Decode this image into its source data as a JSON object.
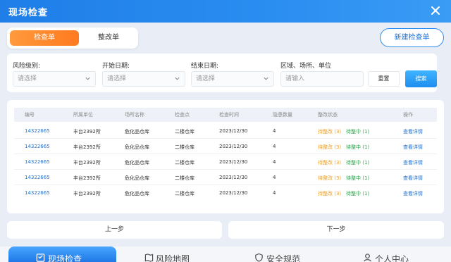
{
  "window": {
    "title": "现场检查"
  },
  "tabs": [
    {
      "label": "检查单",
      "active": true
    },
    {
      "label": "整改单",
      "active": false
    }
  ],
  "new_button": "新建检查单",
  "filters": {
    "risk_level": {
      "label": "风险级别:",
      "placeholder": "请选择"
    },
    "start_date": {
      "label": "开始日期:",
      "placeholder": "请选择"
    },
    "end_date": {
      "label": "结束日期:",
      "placeholder": "请选择"
    },
    "area": {
      "label": "区域、场所、单位",
      "placeholder": "请输入"
    },
    "reset_label": "重置",
    "search_label": "搜索"
  },
  "table": {
    "columns": [
      "编号",
      "所属单位",
      "场所名称",
      "检查点",
      "检查时间",
      "隐患数量",
      "整改状态",
      "操作"
    ],
    "rows": [
      {
        "id": "14322665",
        "unit": "丰台2392所",
        "place": "危化品仓库",
        "point": "二楼仓库",
        "time": "2023/12/30",
        "count": "4",
        "pending": "待整改 (3)",
        "in_progress": "待整中 (1)",
        "action": "查看详情"
      },
      {
        "id": "14322665",
        "unit": "丰台2392所",
        "place": "危化品仓库",
        "point": "二楼仓库",
        "time": "2023/12/30",
        "count": "4",
        "pending": "待整改 (3)",
        "in_progress": "待整中 (1)",
        "action": "查看详情"
      },
      {
        "id": "14322665",
        "unit": "丰台2392所",
        "place": "危化品仓库",
        "point": "二楼仓库",
        "time": "2023/12/30",
        "count": "4",
        "pending": "待整改 (3)",
        "in_progress": "待整中 (1)",
        "action": "查看详情"
      },
      {
        "id": "14322665",
        "unit": "丰台2392所",
        "place": "危化品仓库",
        "point": "二楼仓库",
        "time": "2023/12/30",
        "count": "4",
        "pending": "待整改 (3)",
        "in_progress": "待整中 (1)",
        "action": "查看详情"
      },
      {
        "id": "14322665",
        "unit": "丰台2392所",
        "place": "危化品仓库",
        "point": "二楼仓库",
        "time": "2023/12/30",
        "count": "4",
        "pending": "待整改 (3)",
        "in_progress": "待整中 (1)",
        "action": "查看详情"
      }
    ]
  },
  "pager": {
    "prev": "上一步",
    "next": "下一步"
  },
  "bottom_nav": [
    {
      "label": "现场检查",
      "icon": "inspection-icon",
      "active": true
    },
    {
      "label": "风险地图",
      "icon": "map-icon",
      "active": false
    },
    {
      "label": "安全规范",
      "icon": "shield-icon",
      "active": false
    },
    {
      "label": "个人中心",
      "icon": "user-icon",
      "active": false
    }
  ],
  "colors": {
    "primary": "#2a8df0",
    "accent_orange": "#ff7a1f",
    "status_pending": "#f0a020",
    "status_in_progress": "#2ea44f",
    "link": "#1e6fd0"
  }
}
